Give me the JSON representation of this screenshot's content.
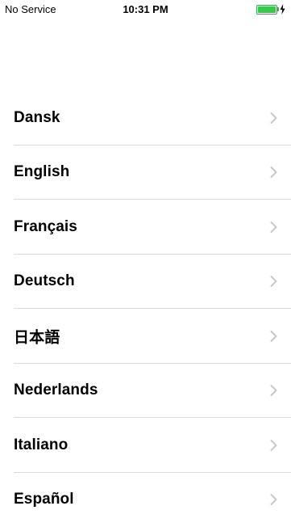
{
  "status_bar": {
    "carrier": "No Service",
    "time": "10:31 PM",
    "battery_color": "#3ec54e"
  },
  "languages": [
    {
      "label": "Dansk"
    },
    {
      "label": "English"
    },
    {
      "label": "Français"
    },
    {
      "label": "Deutsch"
    },
    {
      "label": "日本語"
    },
    {
      "label": "Nederlands"
    },
    {
      "label": "Italiano"
    },
    {
      "label": "Español"
    }
  ],
  "colors": {
    "separator": "#d9d9d9",
    "chevron": "#c7c7cc"
  },
  "icons": {
    "row_disclosure": "chevron-right-icon",
    "charging": "bolt-icon"
  }
}
